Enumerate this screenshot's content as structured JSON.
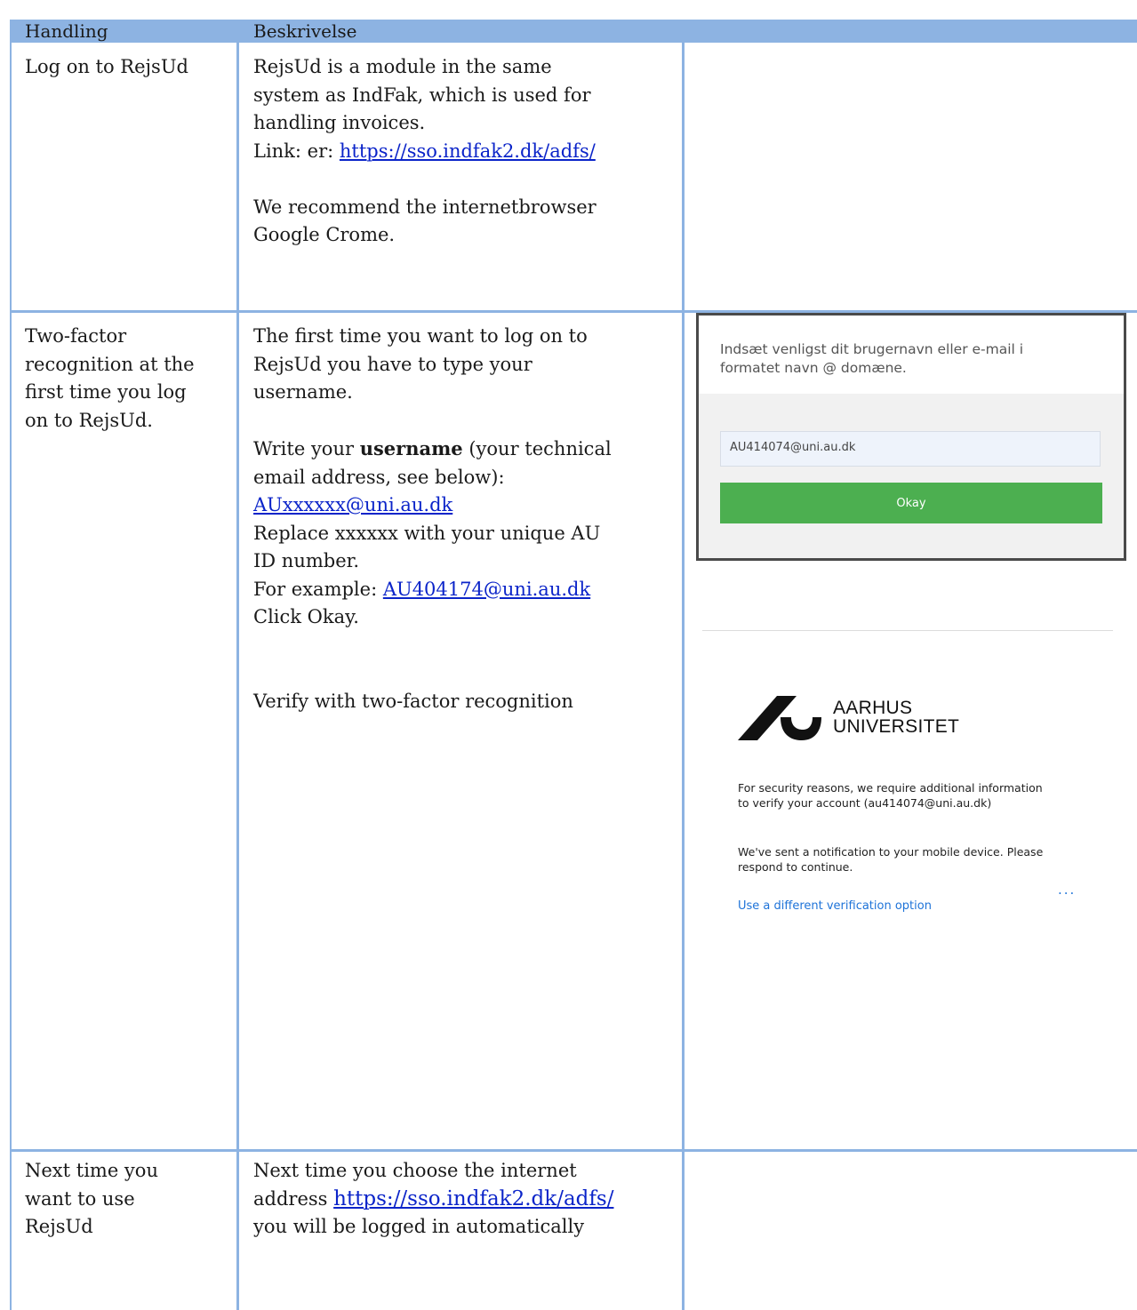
{
  "table": {
    "headers": {
      "col1": "Handling",
      "col2": "Beskrivelse"
    },
    "row1": {
      "action": "Log on to RejsUd",
      "desc_line1": "RejsUd is a module in the same",
      "desc_line2": "system as IndFak, which is used for",
      "desc_line3": "handling invoices.",
      "link_prefix": "Link: er: ",
      "link": "https://sso.indfak2.dk/adfs/",
      "rec_line1": "We recommend the internetbrowser",
      "rec_line2": "Google Crome."
    },
    "row2": {
      "action_line1": "Two-factor",
      "action_line2": "recognition at the",
      "action_line3": "first time you log",
      "action_line4": "on to RejsUd.",
      "p1_line1": "The first time you want to log on to",
      "p1_line2": "RejsUd you have to type your",
      "p1_line3": "username.",
      "p2_prefix": "Write your ",
      "p2_bold": "username",
      "p2_suffix": " (your technical",
      "p2_line2": "email address, see below):",
      "username_link": "AUxxxxxx@uni.au.dk",
      "p2_line4": "Replace xxxxxx with your unique AU",
      "p2_line5": "ID number.",
      "example_prefix": "For example: ",
      "example_link": "AU404174@uni.au.dk",
      "click_okay": "Click Okay.",
      "verify": "Verify with two-factor recognition"
    },
    "row3": {
      "action_line1": "Next time you",
      "action_line2": "want to use",
      "action_line3": "RejsUd",
      "line1": "Next time you choose the internet",
      "line2_prefix": "address ",
      "line2_link": "https://sso.indfak2.dk/adfs/",
      "line3": "you will be logged in automatically"
    }
  },
  "login_dialog": {
    "prompt_line1": "Indsæt venligst dit brugernavn eller e-mail i",
    "prompt_line2": "formatet navn @ domæne.",
    "input_value": "AU414074@uni.au.dk",
    "okay_button": "Okay",
    "button_color": "#4caf50"
  },
  "verification": {
    "logo_line1": "AARHUS",
    "logo_line2": "UNIVERSITET",
    "security_line1": "For security reasons, we require additional information",
    "security_line2": "to verify your account (au414074@uni.au.dk)",
    "notify_line1": "We've sent a notification to your mobile device. Please",
    "notify_line2": "respond to continue.",
    "dots": "...",
    "different_option": "Use a different verification option",
    "link_color": "#1e73d8"
  },
  "colors": {
    "header_band": "#8db3e2",
    "link": "#0b24c9"
  }
}
